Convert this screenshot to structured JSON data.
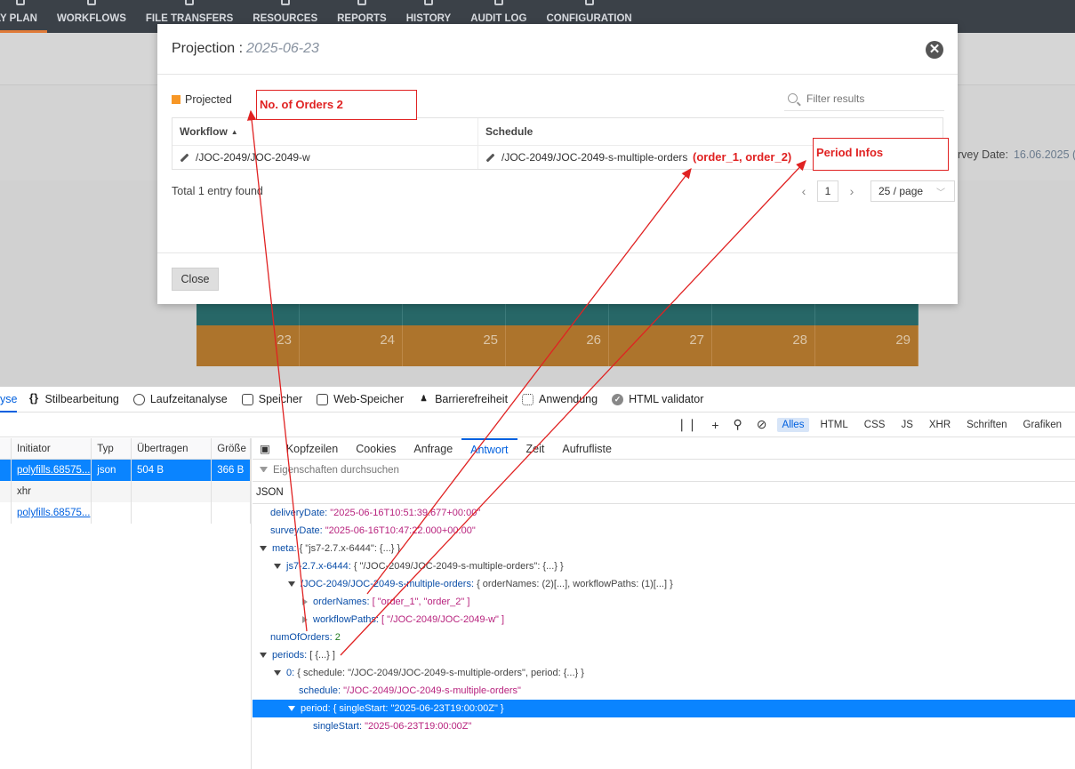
{
  "nav": {
    "items": [
      "LY PLAN",
      "WORKFLOWS",
      "FILE TRANSFERS",
      "RESOURCES",
      "REPORTS",
      "HISTORY",
      "AUDIT LOG",
      "CONFIGURATION"
    ]
  },
  "background": {
    "survey_label": "rvey Date:",
    "survey_value": "16.06.2025 (",
    "calendar_days": [
      "23",
      "24",
      "25",
      "26",
      "27",
      "28",
      "29"
    ]
  },
  "modal": {
    "title": "Projection :",
    "date": "2025-06-23",
    "legend_label": "Projected",
    "legend_color": "#f79726",
    "filter_placeholder": "Filter results",
    "columns": {
      "workflow": "Workflow",
      "schedule": "Schedule"
    },
    "rows": [
      {
        "workflow": "/JOC-2049/JOC-2049-w",
        "schedule": "/JOC-2049/JOC-2049-s-multiple-orders"
      }
    ],
    "total": "Total 1 entry found",
    "page": "1",
    "page_size": "25 / page",
    "close_label": "Close"
  },
  "annotations": {
    "orders": "No. of Orders 2",
    "orders_list": "(order_1, order_2)",
    "period": "Period Infos",
    "color": "#e02222"
  },
  "devtools": {
    "tabs": [
      "yse",
      "Stilbearbeitung",
      "Laufzeitanalyse",
      "Speicher",
      "Web-Speicher",
      "Barrierefreiheit",
      "Anwendung",
      "HTML validator"
    ],
    "filters": [
      "Alles",
      "HTML",
      "CSS",
      "JS",
      "XHR",
      "Schriften",
      "Grafiken"
    ],
    "req_columns": [
      "Initiator",
      "Typ",
      "Übertragen",
      "Größe"
    ],
    "requests": [
      {
        "initiator": "polyfills.68575...",
        "type": "json",
        "transferred": "504 B",
        "size": "366 B"
      },
      {
        "initiator": "xhr",
        "type": "",
        "transferred": "",
        "size": ""
      },
      {
        "initiator": "polyfills.68575...",
        "type": "",
        "transferred": "",
        "size": ""
      }
    ],
    "resp_tabs": [
      "Kopfzeilen",
      "Cookies",
      "Anfrage",
      "Antwort",
      "Zeit",
      "Aufrufliste"
    ],
    "resp_filter": "Eigenschaften durchsuchen",
    "json_label": "JSON",
    "json": {
      "l1_key": "deliveryDate:",
      "l1_val": "\"2025-06-16T10:51:39.677+00:00\"",
      "l2_key": "surveyDate:",
      "l2_val": "\"2025-06-16T10:47:22.000+00:00\"",
      "l3_key": "meta:",
      "l3_val": "{ \"js7-2.7.x-6444\": {...} }",
      "l4_key": "js7-2.7.x-6444:",
      "l4_val": "{ \"/JOC-2049/JOC-2049-s-multiple-orders\": {...} }",
      "l5_key": "/JOC-2049/JOC-2049-s-multiple-orders:",
      "l5_val": "{ orderNames: (2)[...], workflowPaths: (1)[...] }",
      "l6_key": "orderNames:",
      "l6_val": "[ \"order_1\", \"order_2\" ]",
      "l7_key": "workflowPaths:",
      "l7_val": "[ \"/JOC-2049/JOC-2049-w\" ]",
      "l8_key": "numOfOrders:",
      "l8_val": "2",
      "l9_key": "periods:",
      "l9_val": "[ {...} ]",
      "l10_key": "0:",
      "l10_val": "{ schedule: \"/JOC-2049/JOC-2049-s-multiple-orders\", period: {...} }",
      "l11_key": "schedule:",
      "l11_val": "\"/JOC-2049/JOC-2049-s-multiple-orders\"",
      "l12_key": "period:",
      "l12_val": "{ singleStart: \"2025-06-23T19:00:00Z\" }",
      "l13_key": "singleStart:",
      "l13_val": "\"2025-06-23T19:00:00Z\""
    }
  }
}
